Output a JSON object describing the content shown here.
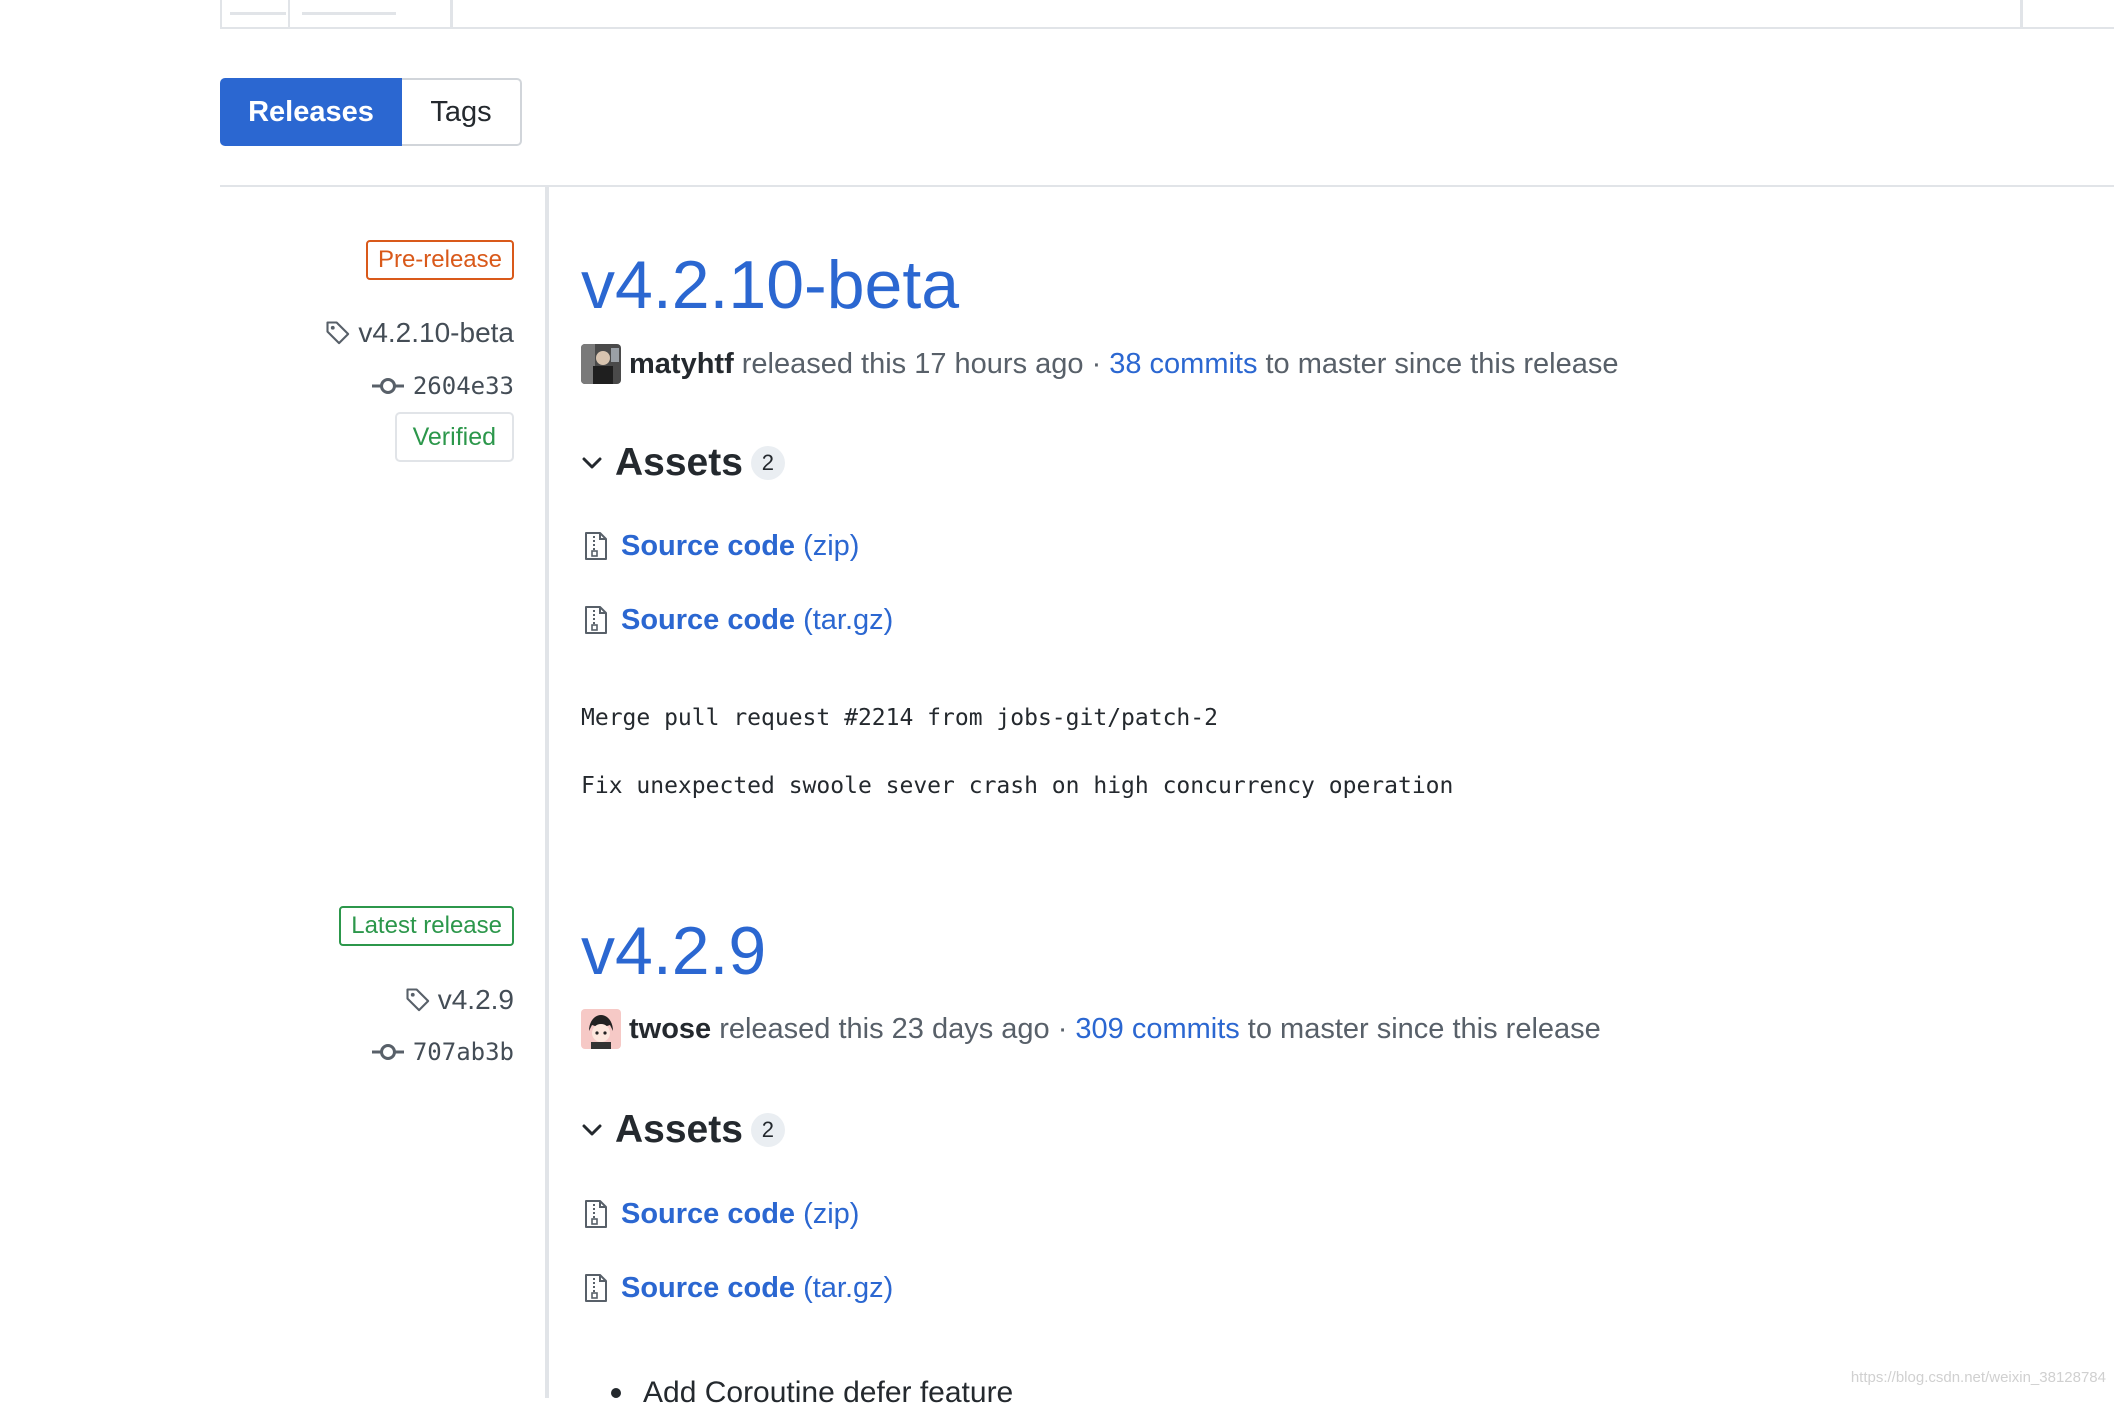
{
  "tabs": {
    "releases": "Releases",
    "tags": "Tags"
  },
  "releases": [
    {
      "label": "Pre-release",
      "tag": "v4.2.10-beta",
      "commit": "2604e33",
      "verified": "Verified",
      "title": "v4.2.10-beta",
      "author": "matyhtf",
      "released_text": "released this 17 hours ago ·",
      "commits_link": "38 commits",
      "commits_suffix": "to master since this release",
      "assets_label": "Assets",
      "assets_count": "2",
      "assets": [
        {
          "name": "Source code",
          "ext": "(zip)"
        },
        {
          "name": "Source code",
          "ext": "(tar.gz)"
        }
      ],
      "body": [
        "Merge pull request #2214 from jobs-git/patch-2",
        "Fix unexpected swoole sever crash on high concurrency operation"
      ]
    },
    {
      "label": "Latest release",
      "tag": "v4.2.9",
      "commit": "707ab3b",
      "title": "v4.2.9",
      "author": "twose",
      "released_text": "released this 23 days ago ·",
      "commits_link": "309 commits",
      "commits_suffix": "to master since this release",
      "assets_label": "Assets",
      "assets_count": "2",
      "assets": [
        {
          "name": "Source code",
          "ext": "(zip)"
        },
        {
          "name": "Source code",
          "ext": "(tar.gz)"
        }
      ],
      "bullets": [
        "Add Coroutine defer feature"
      ]
    }
  ],
  "watermark": "https://blog.csdn.net/weixin_38128784",
  "colors": {
    "primary_link": "#2b67d1",
    "pre_release": "#d9591a",
    "latest_release": "#2c974b",
    "verified": "#2c974b"
  },
  "icons": {
    "tag": "tag-icon",
    "commit": "git-commit-icon",
    "chevron": "chevron-down-icon",
    "archive": "file-zip-icon"
  }
}
